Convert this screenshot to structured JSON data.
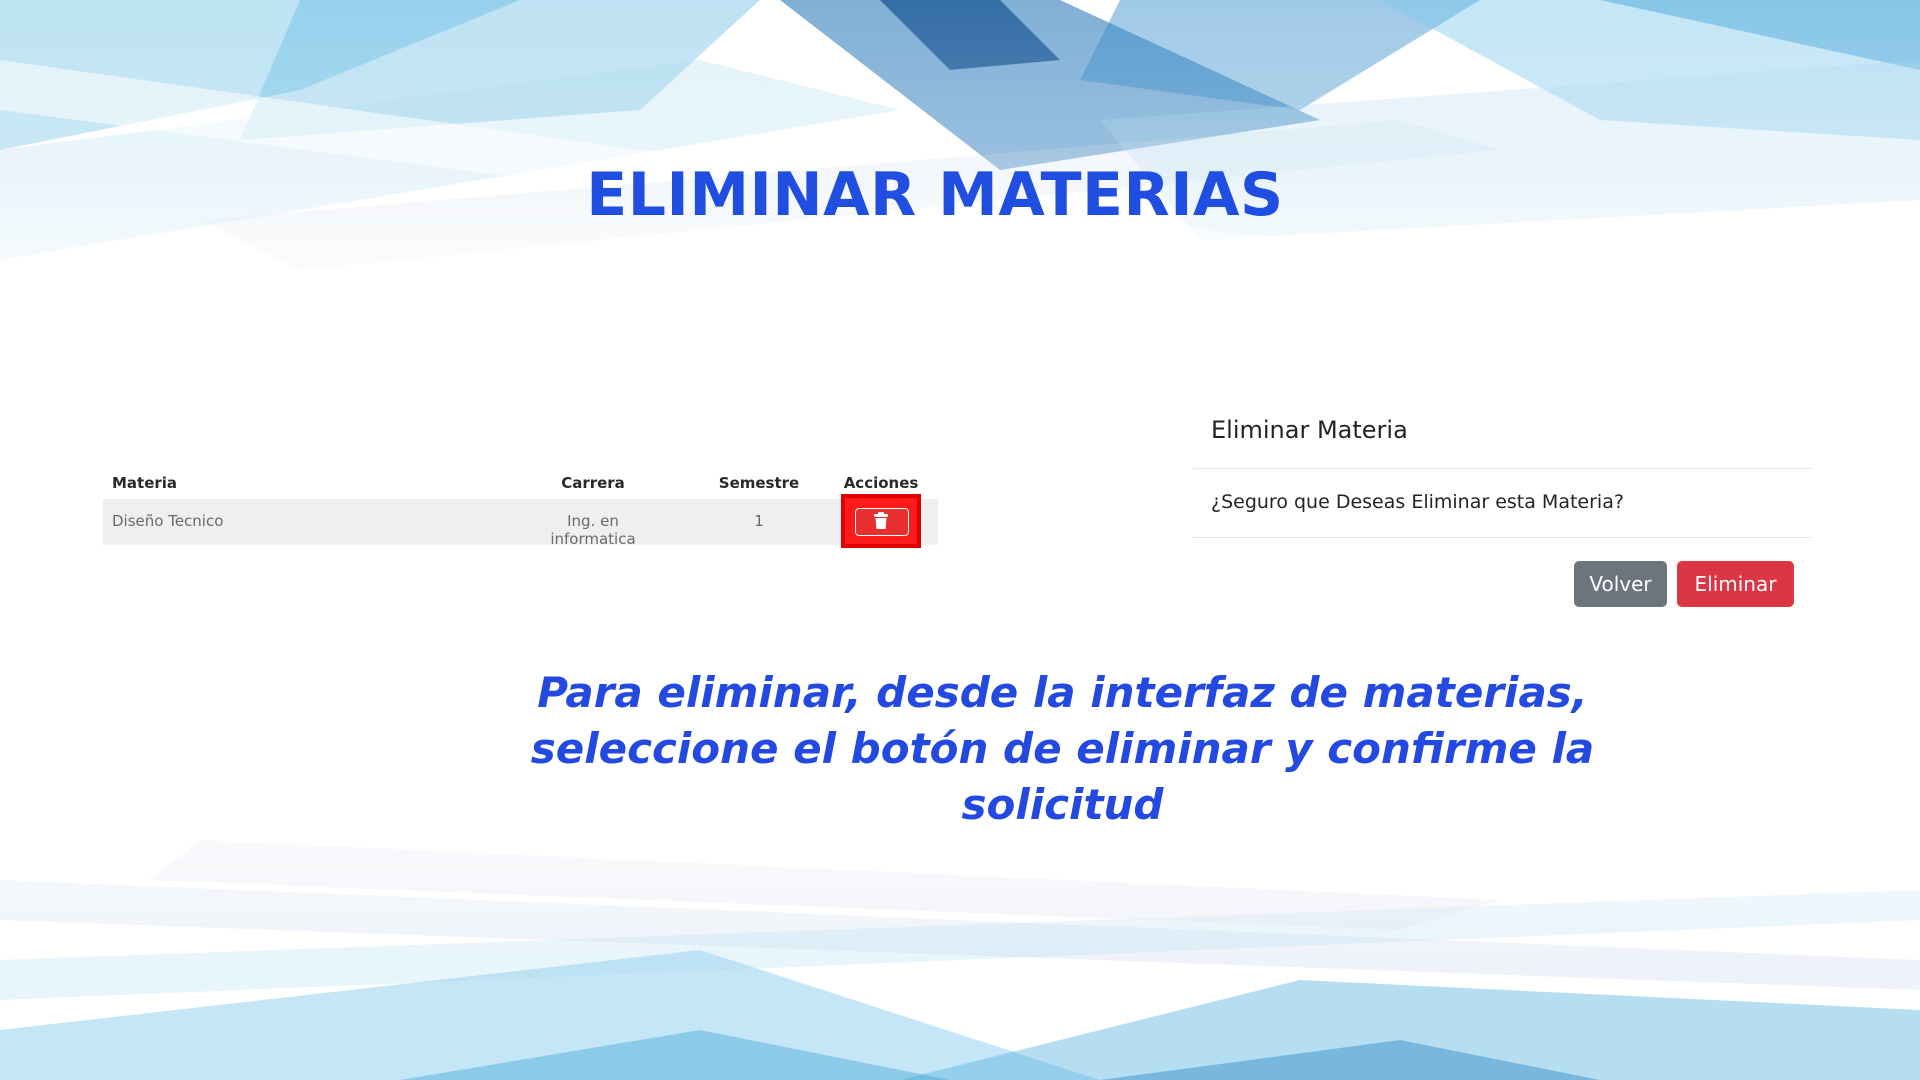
{
  "slide": {
    "title": "ELIMINAR MATERIAS",
    "caption": "Para eliminar, desde la interfaz de materias, seleccione el botón de eliminar y confirme la solicitud"
  },
  "table": {
    "headers": {
      "materia": "Materia",
      "carrera": "Carrera",
      "semestre": "Semestre",
      "acciones": "Acciones"
    },
    "rows": [
      {
        "materia": "Diseño Tecnico",
        "carrera": "Ing. en informatica",
        "semestre": "1",
        "action_icon": "trash-icon"
      }
    ]
  },
  "modal": {
    "title": "Eliminar Materia",
    "message": "¿Seguro que Deseas Eliminar esta Materia?",
    "cancel_label": "Volver",
    "confirm_label": "Eliminar"
  },
  "colors": {
    "title": "#1f4ee0",
    "caption": "#2449e0",
    "delete_highlight": "#ff1a1a",
    "btn_secondary": "#6c757d",
    "btn_danger": "#dc3545"
  }
}
